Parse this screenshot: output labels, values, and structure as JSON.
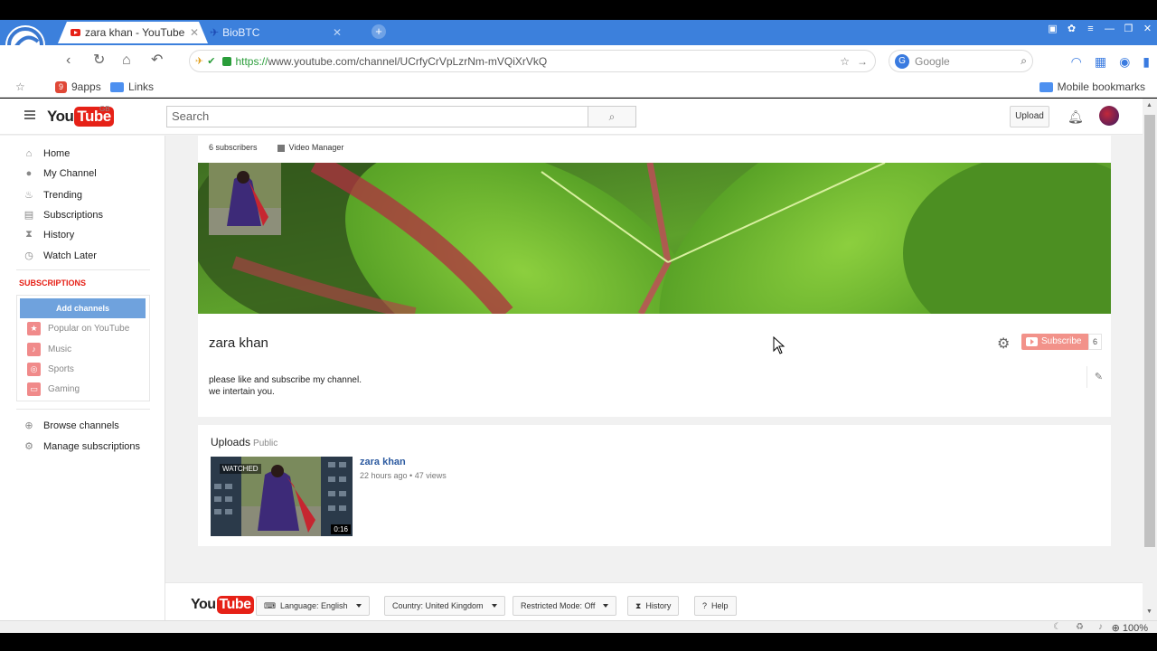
{
  "browser": {
    "tabs": [
      {
        "title": "zara khan - YouTube",
        "active": true
      },
      {
        "title": "BioBTC",
        "active": false
      }
    ],
    "url_protocol": "https://",
    "url_rest": "www.youtube.com/channel/UCrfyCrVpLzrNm-mVQiXrVkQ",
    "search_placeholder": "Google",
    "bookmarks": [
      "9apps",
      "Links"
    ],
    "mobile_bookmarks": "Mobile bookmarks",
    "zoom": "100%"
  },
  "youtube": {
    "region": "GB",
    "search_placeholder": "Search",
    "upload": "Upload",
    "sidebar": {
      "items": [
        "Home",
        "My Channel",
        "Trending",
        "Subscriptions",
        "History",
        "Watch Later"
      ],
      "subscriptions_heading": "SUBSCRIPTIONS",
      "add_channels": "Add channels",
      "subs": [
        "Popular on YouTube",
        "Music",
        "Sports",
        "Gaming"
      ],
      "bottom": [
        "Browse channels",
        "Manage subscriptions"
      ]
    },
    "channel": {
      "subscribers_text": "6 subscribers",
      "video_manager": "Video Manager",
      "name": "zara khan",
      "subscribe": "Subscribe",
      "subscriber_count": "6",
      "description_line1": "please like and subscribe my channel.",
      "description_line2": "we intertain you."
    },
    "uploads": {
      "title": "Uploads",
      "visibility": "Public",
      "video": {
        "title": "zara khan",
        "meta": "22 hours ago • 47 views",
        "duration": "0:16",
        "watched": "WATCHED"
      }
    },
    "footer": {
      "language": "Language: English",
      "country": "Country: United Kingdom",
      "restricted": "Restricted Mode: Off",
      "history": "History",
      "help": "Help"
    }
  },
  "colors": {
    "tabbar": "#3c80dc",
    "youtube_red": "#e62117",
    "link_blue": "#2c5aa0"
  }
}
